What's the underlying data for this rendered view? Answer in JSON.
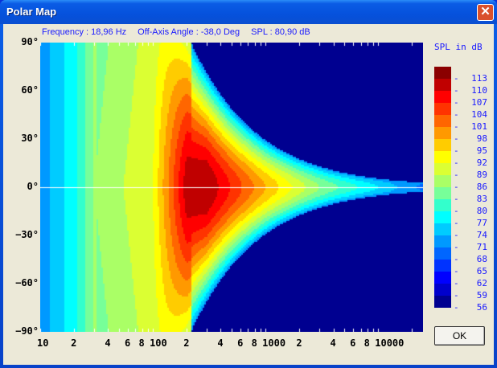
{
  "window": {
    "title": "Polar Map",
    "close_label": "✕",
    "ok_label": "OK"
  },
  "info": {
    "frequency": "Frequency : 18,96 Hz",
    "angle": "Off-Axis Angle : -38,0 Deg",
    "spl": "SPL : 80,90 dB"
  },
  "chart_data": {
    "type": "heatmap",
    "title": "Polar Map",
    "xlabel": "Frequency (Hz)",
    "ylabel": "Off-Axis Angle",
    "xscale": "log",
    "xlim": [
      10,
      25000
    ],
    "ylim": [
      -90,
      90
    ],
    "x_tick_labels": [
      [
        "10",
        10
      ],
      [
        "2",
        20
      ],
      [
        "4",
        40
      ],
      [
        "6",
        60
      ],
      [
        "8",
        80
      ],
      [
        "100",
        100
      ],
      [
        "2",
        200
      ],
      [
        "4",
        400
      ],
      [
        "6",
        600
      ],
      [
        "8",
        800
      ],
      [
        "1000",
        1000
      ],
      [
        "2",
        2000
      ],
      [
        "4",
        4000
      ],
      [
        "6",
        6000
      ],
      [
        "8",
        8000
      ],
      [
        "10000",
        10000
      ]
    ],
    "y_tick_labels": [
      "90°",
      "60°",
      "30°",
      "0°",
      "−30°",
      "−60°",
      "−90°"
    ],
    "y_ticks": [
      90,
      60,
      30,
      0,
      -30,
      -60,
      -90
    ],
    "legend_title": "SPL in dB",
    "levels": [
      113,
      110,
      107,
      104,
      101,
      98,
      95,
      92,
      89,
      86,
      83,
      80,
      77,
      74,
      71,
      68,
      65,
      62,
      59,
      56
    ],
    "colors": [
      "#8b0000",
      "#c00000",
      "#ff0000",
      "#ff3300",
      "#ff6600",
      "#ff9900",
      "#ffcc00",
      "#ffff00",
      "#dbff33",
      "#aaff66",
      "#77ff99",
      "#33ffcc",
      "#00ffff",
      "#00ccff",
      "#0099ff",
      "#0066ff",
      "#0033ff",
      "#0000ff",
      "#0000cc",
      "#000090"
    ],
    "on_axis_spl": [
      [
        10,
        72
      ],
      [
        20,
        79
      ],
      [
        30,
        86
      ],
      [
        100,
        92
      ],
      [
        200,
        112
      ],
      [
        300,
        113
      ],
      [
        1000,
        98
      ],
      [
        3000,
        86
      ],
      [
        25000,
        70
      ]
    ]
  }
}
